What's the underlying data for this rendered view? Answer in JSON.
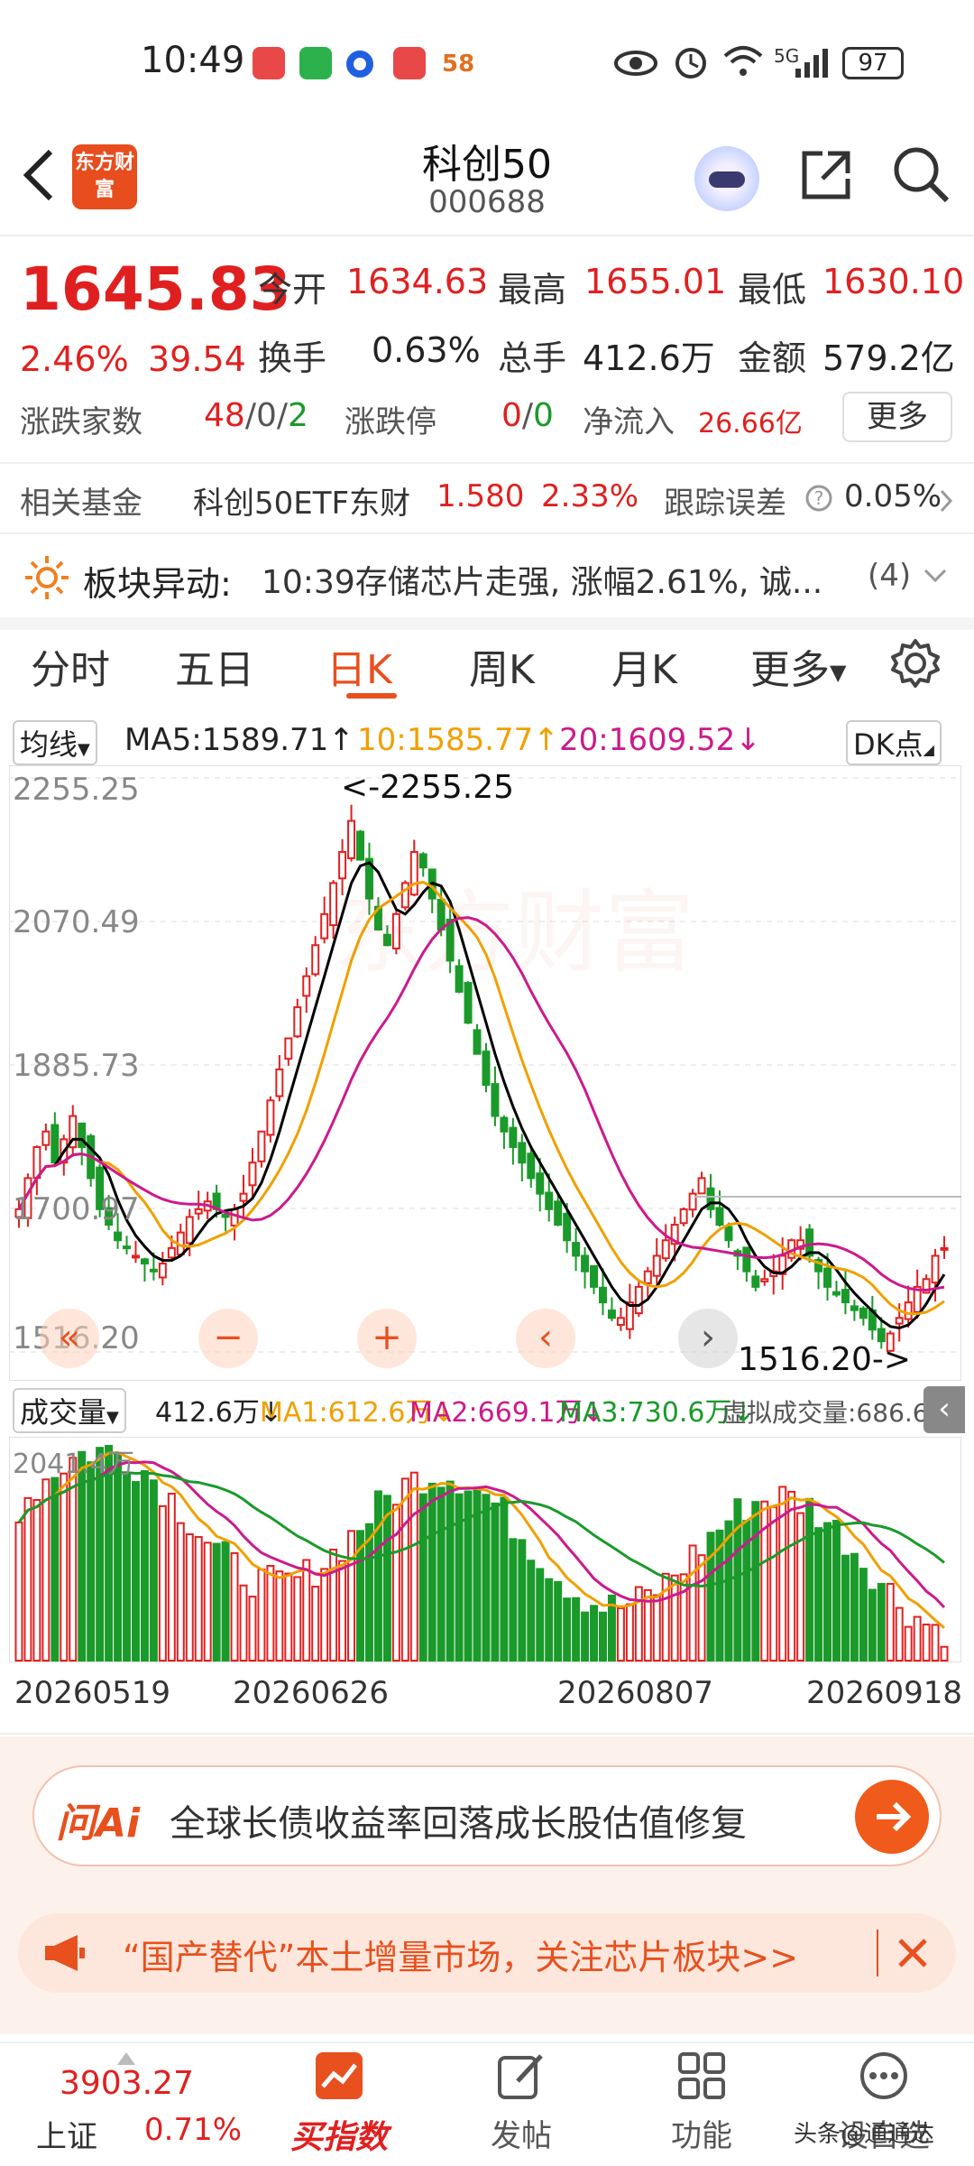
{
  "status_bar": {
    "time": "10:49",
    "network": "5G",
    "battery": "97",
    "app_badge": "58"
  },
  "header": {
    "brand": "东方财富",
    "title": "科创50",
    "code": "000688"
  },
  "quote": {
    "price": "1645.83",
    "change_pct": "2.46%",
    "change": "39.54",
    "open_label": "今开",
    "open": "1634.63",
    "high_label": "最高",
    "high": "1655.01",
    "low_label": "最低",
    "low": "1630.10",
    "turnover_label": "换手",
    "turnover": "0.63%",
    "volume_label": "总手",
    "volume": "412.6万",
    "amount_label": "金额",
    "amount": "579.2亿",
    "updown_label": "涨跌家数",
    "up_count": "48",
    "sep1": "/",
    "flat_count": "0",
    "sep2": "/",
    "down_count": "2",
    "limit_label": "涨跌停",
    "limit_up": "0",
    "limit_sep": "/",
    "limit_down": "0",
    "netflow_label": "净流入",
    "netflow": "26.66亿",
    "more_label": "更多"
  },
  "fund": {
    "label": "相关基金",
    "name": "科创50ETF东财",
    "price": "1.580",
    "pct": "2.33%",
    "tracking_label": "跟踪误差",
    "tracking": "0.05%"
  },
  "alert": {
    "label": "板块异动:",
    "text": "10:39存储芯片走强, 涨幅2.61%, 诚...",
    "count": "(4)"
  },
  "tabs": [
    "分时",
    "五日",
    "日K",
    "周K",
    "月K",
    "更多"
  ],
  "active_tab": 2,
  "ma": {
    "label": "均线",
    "ma5": "MA5:1589.71",
    "ma10": "10:1585.77",
    "ma20": "20:1609.52",
    "dk": "DK点"
  },
  "chart_data": {
    "type": "candlestick",
    "y_ticks": [
      "2255.25",
      "2070.49",
      "1885.73",
      "1700.97",
      "1516.20"
    ],
    "ylim": [
      1516.2,
      2255.25
    ],
    "annotations": {
      "max_label": "<-2255.25",
      "min_label": "1516.20->"
    },
    "x_labels": [
      "20260519",
      "20260626",
      "20260807",
      "20260918"
    ],
    "closes": [
      1700,
      1740,
      1780,
      1800,
      1760,
      1790,
      1820,
      1780,
      1740,
      1700,
      1680,
      1660,
      1650,
      1640,
      1630,
      1620,
      1630,
      1650,
      1670,
      1690,
      1700,
      1710,
      1700,
      1690,
      1700,
      1720,
      1760,
      1800,
      1840,
      1880,
      1920,
      1960,
      2000,
      2040,
      2080,
      2120,
      2160,
      2200,
      2150,
      2100,
      2060,
      2040,
      2080,
      2120,
      2160,
      2140,
      2100,
      2060,
      2020,
      1980,
      1940,
      1900,
      1860,
      1820,
      1800,
      1780,
      1760,
      1740,
      1720,
      1700,
      1680,
      1660,
      1640,
      1620,
      1600,
      1580,
      1560,
      1560,
      1580,
      1600,
      1620,
      1640,
      1660,
      1680,
      1700,
      1720,
      1740,
      1700,
      1680,
      1660,
      1640,
      1620,
      1600,
      1610,
      1620,
      1640,
      1660,
      1660,
      1640,
      1620,
      1600,
      1590,
      1580,
      1570,
      1560,
      1545,
      1530,
      1540,
      1560,
      1580,
      1600,
      1610,
      1640,
      1650
    ],
    "ma5_label": "MA5",
    "ma10_label": "10",
    "ma20_label": "20",
    "colors": {
      "up": "#e02020",
      "down": "#1a9a2a",
      "ma5": "#000000",
      "ma10": "#f0a000",
      "ma20": "#cc1a8c"
    }
  },
  "volume": {
    "label": "成交量",
    "value": "412.6万",
    "ma1": "MA1:612.6万",
    "ma2": "MA2:669.1万",
    "ma3": "MA3:730.6万",
    "virtual": "虚拟成交量:686.6万",
    "y_tick": "2041.4万"
  },
  "ai_banner": {
    "brand": "问Ai",
    "text": "全球长债收益率回落成长股估值修复"
  },
  "notice": {
    "text": "“国产替代”本土增量市场，关注芯片板块>>"
  },
  "bottom_nav": {
    "index_name": "上证",
    "index_value": "3903.27",
    "index_pct": "0.71%",
    "buy": "买指数",
    "post": "发帖",
    "func": "功能",
    "watch": "设自选",
    "watermark": "头条@通通达"
  }
}
